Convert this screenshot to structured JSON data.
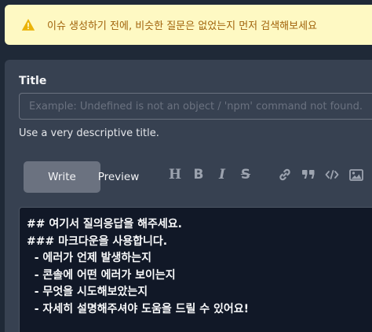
{
  "alert": {
    "icon": "warning-icon",
    "color": "#eab308",
    "text": "이슈 생성하기 전에, 비슷한 질문은 없었는지 먼저 검색해보세요"
  },
  "form": {
    "title_label": "Title",
    "title_placeholder": "Example: Undefined is not an object / 'npm' command not found.",
    "title_value": "",
    "hint": "Use a very descriptive title."
  },
  "editor_tabs": {
    "write": "Write",
    "preview": "Preview",
    "active": "Write"
  },
  "toolbar": {
    "heading": "H",
    "bold": "B",
    "italic": "I",
    "strike": "S",
    "icons": [
      "heading-icon",
      "bold-icon",
      "italic-icon",
      "strikethrough-icon",
      "link-icon",
      "quote-icon",
      "code-icon",
      "image-icon"
    ]
  },
  "editor": {
    "lines": [
      "## 여기서 질의응답을 해주세요.",
      "### 마크다운을 사용합니다.",
      "  - 에러가 언제 발생하는지",
      "  - 콘솔에 어떤 에러가 보이는지",
      "  - 무엇을 시도해보았는지",
      "  - 자세히 설명해주셔야 도움을 드릴 수 있어요!"
    ]
  }
}
